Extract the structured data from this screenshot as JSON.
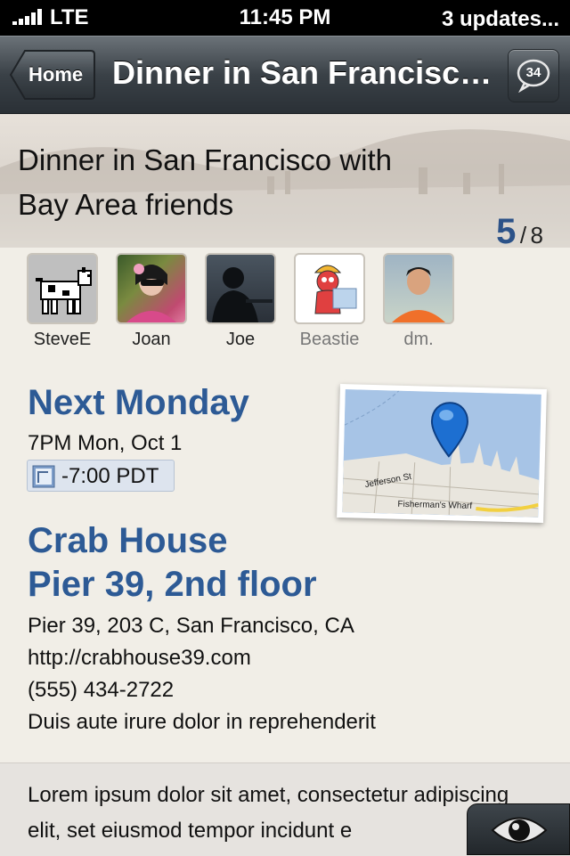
{
  "status_bar": {
    "carrier": "LTE",
    "time": "11:45 PM",
    "notice": "3 updates..."
  },
  "nav": {
    "back_label": "Home",
    "title": "Dinner in San Francisco with Bay Area friends",
    "comment_count": "34"
  },
  "event": {
    "title_line1": "Dinner in San Francisco with",
    "title_line2": "Bay Area friends",
    "going": "5",
    "separator": "/",
    "total": "8"
  },
  "attendees": [
    {
      "name": "SteveE",
      "status": "going"
    },
    {
      "name": "Joan",
      "status": "going"
    },
    {
      "name": "Joe",
      "status": "going"
    },
    {
      "name": "Beastie",
      "status": "pending"
    },
    {
      "name": "dm.",
      "status": "pending"
    }
  ],
  "when": {
    "heading": "Next Monday",
    "detail": "7PM Mon, Oct 1",
    "timezone": "-7:00 PDT"
  },
  "map": {
    "street_label": "Jefferson St",
    "area_label": "Fisherman's Wharf"
  },
  "where": {
    "name": "Crab House",
    "sub": "Pier 39, 2nd floor",
    "address": "Pier 39, 203 C, San Francisco, CA",
    "url": "http://crabhouse39.com",
    "phone": "(555) 434-2722",
    "note": "Duis aute irure dolor in reprehenderit"
  },
  "description": {
    "text": "Lorem ipsum dolor sit amet, consectetur adipiscing elit, set eiusmod tempor incidunt e"
  },
  "colors": {
    "accent_blue": "#2d5a95",
    "nav_dark": "#2a3036",
    "paper": "#f1eee7"
  }
}
